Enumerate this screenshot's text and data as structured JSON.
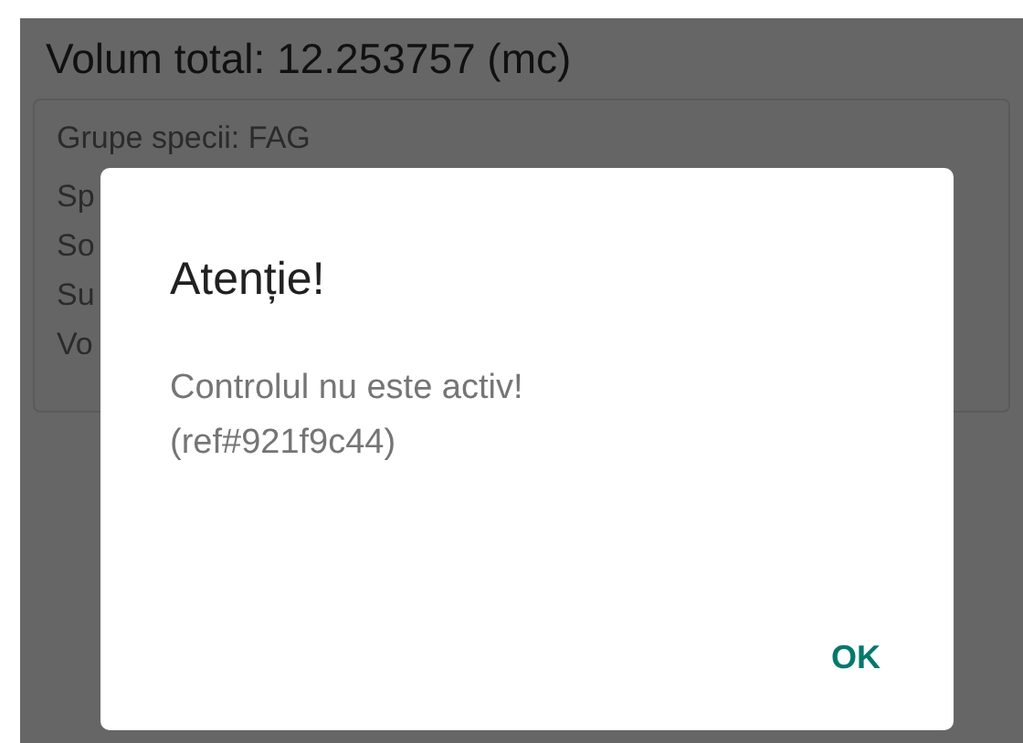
{
  "header": {
    "title": "Volum total: 12.253757 (mc)"
  },
  "card": {
    "lines": [
      "Grupe specii: FAG",
      "Sp",
      "So",
      "Su",
      "Vo"
    ]
  },
  "dialog": {
    "title": "Atenție!",
    "message_lines": [
      "Controlul nu este activ!",
      "(ref#921f9c44)"
    ],
    "buttons": [
      "OK"
    ]
  }
}
